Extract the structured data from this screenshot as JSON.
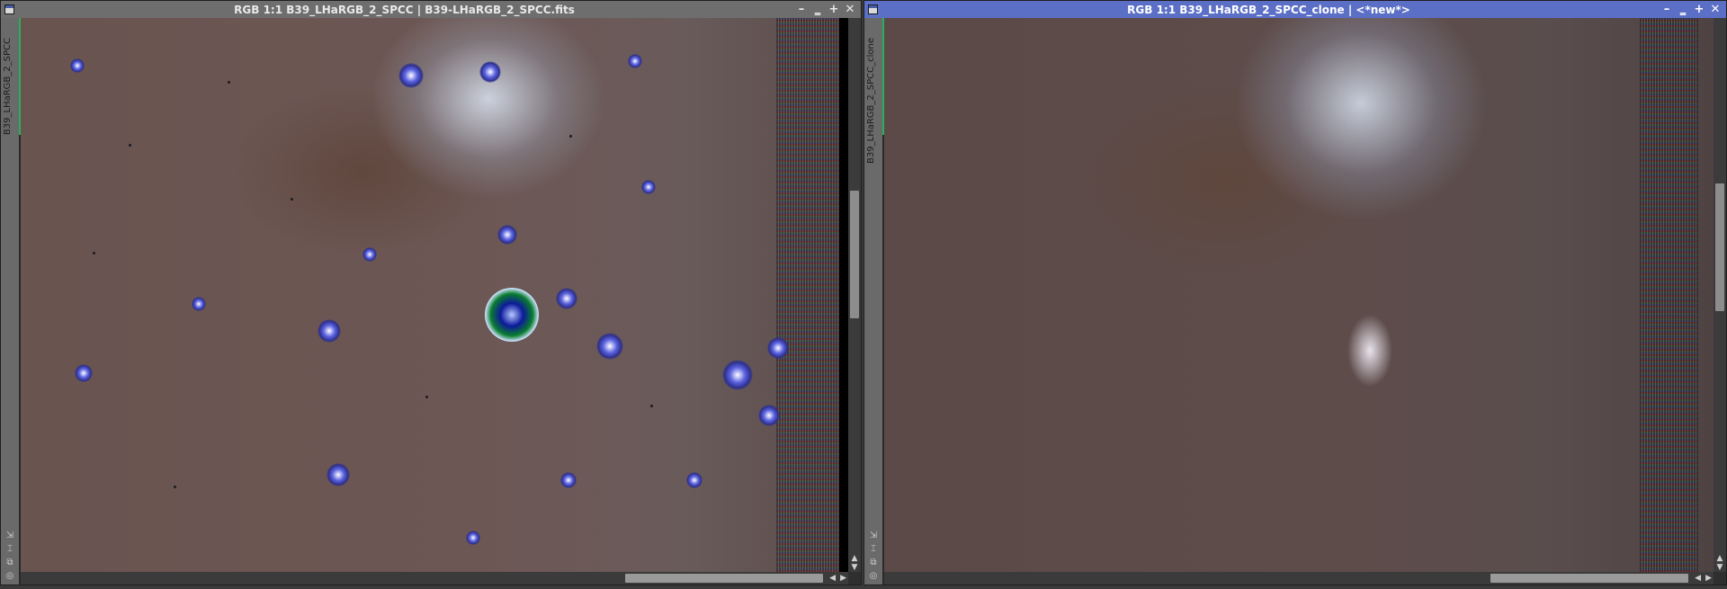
{
  "left_window": {
    "title": "RGB 1:1 B39_LHaRGB_2_SPCC | B39-LHaRGB_2_SPCC.fits",
    "side_tab_label": "B39_LHaRGB_2_SPCC",
    "buttons": [
      "–",
      "‗",
      "+",
      "✕"
    ]
  },
  "right_window": {
    "title": "RGB 1:1 B39_LHaRGB_2_SPCC_clone | <*new*>",
    "side_tab_label": "B39_LHaRGB_2_SPCC_clone",
    "buttons": [
      "–",
      "‗",
      "+",
      "✕"
    ]
  },
  "colors": {
    "active_titlebar": "#5b6fc7",
    "inactive_titlebar": "#6e6e6e",
    "side_tab_accent": "#27b15d"
  },
  "icons": [
    "window-menu-icon",
    "minimize-icon",
    "shade-icon",
    "maximize-icon",
    "close-icon",
    "zoom-icon",
    "fit-icon",
    "shadow-icon",
    "settings-icon"
  ]
}
